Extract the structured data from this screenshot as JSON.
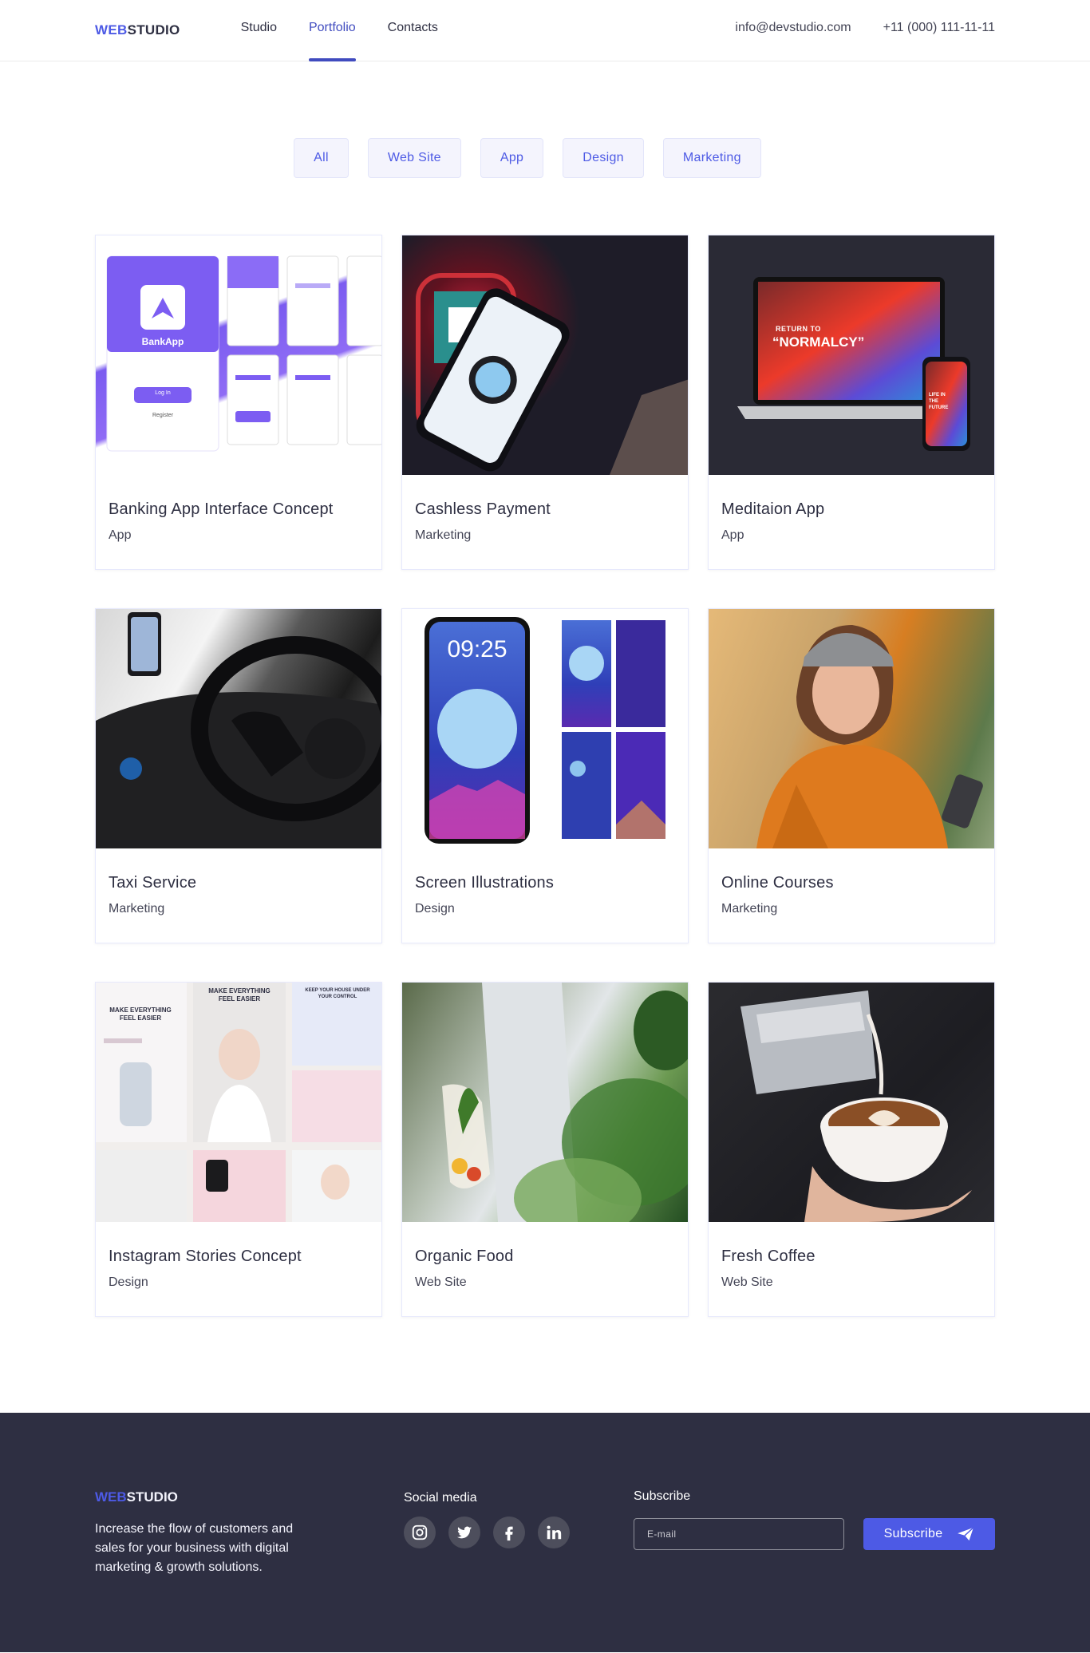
{
  "header": {
    "logo": {
      "part1": "Web",
      "part2": "Studio"
    },
    "nav": [
      {
        "label": "Studio",
        "active": false
      },
      {
        "label": "Portfolio",
        "active": true
      },
      {
        "label": "Contacts",
        "active": false
      }
    ],
    "email": "info@devstudio.com",
    "phone": "+11 (000) 111-11-11"
  },
  "filters": [
    "All",
    "Web Site",
    "App",
    "Design",
    "Marketing"
  ],
  "projects": [
    {
      "title": "Banking App Interface Concept",
      "category": "App"
    },
    {
      "title": "Cashless Payment",
      "category": "Marketing"
    },
    {
      "title": "Meditaion App",
      "category": "App"
    },
    {
      "title": "Taxi Service",
      "category": "Marketing"
    },
    {
      "title": "Screen Illustrations",
      "category": "Design"
    },
    {
      "title": "Online Courses",
      "category": "Marketing"
    },
    {
      "title": "Instagram Stories Concept",
      "category": "Design"
    },
    {
      "title": "Organic Food",
      "category": "Web Site"
    },
    {
      "title": "Fresh Coffee",
      "category": "Web Site"
    }
  ],
  "thumb_text": {
    "bank_app": "BankApp",
    "bank_login": "Log In",
    "bank_register": "Register",
    "meditation_heading": "RETURN TO",
    "meditation_title": "“NORMALCY”",
    "meditation_phone": "LIFE IN THE FUTURE",
    "screen_time": "09:25",
    "insta_heading_1": "MAKE EVERYTHING FEEL EASIER",
    "insta_heading_2": "MAKE EVERYTHING FEEL EASIER",
    "insta_heading_3": "KEEP YOUR HOUSE UNDER YOUR CONTROL"
  },
  "footer": {
    "logo": {
      "part1": "Web",
      "part2": "Studio"
    },
    "description": "Increase the flow of customers and sales for your business with digital marketing & growth solutions.",
    "social_heading": "Social media",
    "social_icons": [
      "instagram-icon",
      "twitter-icon",
      "facebook-icon",
      "linkedin-icon"
    ],
    "subscribe_heading": "Subscribe",
    "email_placeholder": "E-mail",
    "subscribe_button": "Subscribe"
  },
  "colors": {
    "accent": "#4d5ae5",
    "nav_active": "#404bbf",
    "dark": "#2e2f42",
    "filter_bg": "#f4f4fd"
  }
}
